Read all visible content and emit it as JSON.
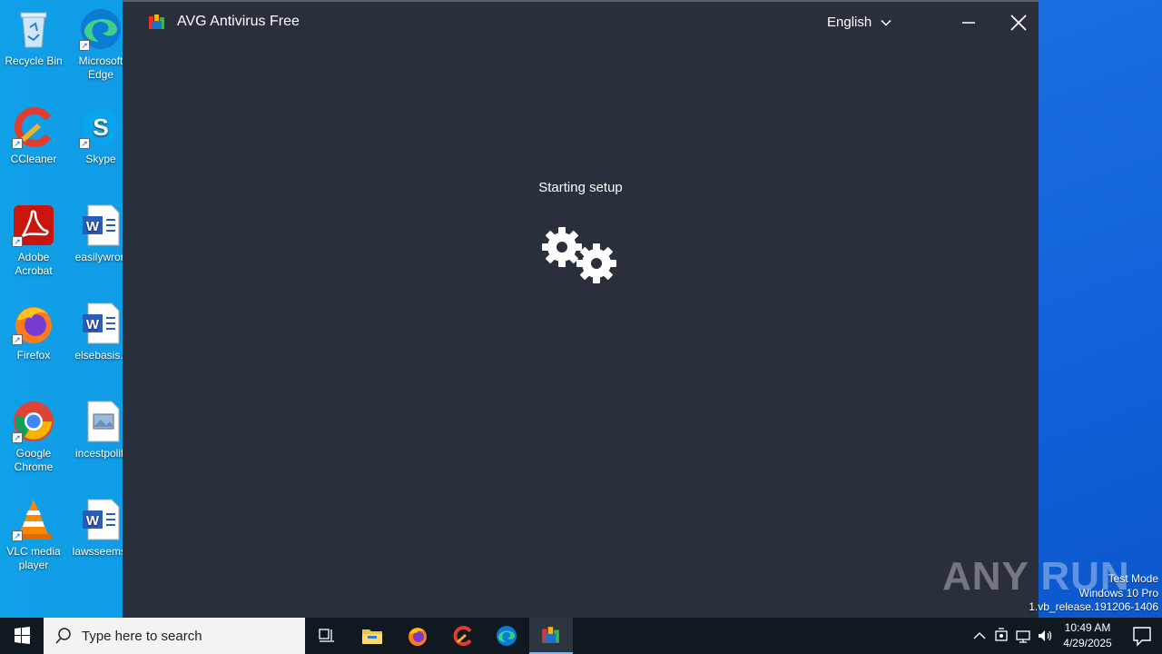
{
  "desktop": {
    "icons": [
      {
        "name": "recycle-bin",
        "label": "Recycle Bin"
      },
      {
        "name": "microsoft-edge",
        "label": "Microsoft Edge"
      },
      {
        "name": "ccleaner",
        "label": "CCleaner"
      },
      {
        "name": "skype",
        "label": "Skype"
      },
      {
        "name": "adobe-acrobat",
        "label": "Adobe Acrobat"
      },
      {
        "name": "easilywron",
        "label": "easilywron"
      },
      {
        "name": "firefox",
        "label": "Firefox"
      },
      {
        "name": "elsebasis",
        "label": "elsebasis.r"
      },
      {
        "name": "google-chrome",
        "label": "Google Chrome"
      },
      {
        "name": "incestpoliti",
        "label": "incestpoliti"
      },
      {
        "name": "vlc",
        "label": "VLC media player"
      },
      {
        "name": "lawsseems",
        "label": "lawsseems."
      }
    ]
  },
  "window": {
    "title": "AVG Antivirus Free",
    "language": "English",
    "status": "Starting setup"
  },
  "watermark": {
    "text": "ANY RUN"
  },
  "system_info": {
    "line1": "Test Mode",
    "line2": "Windows 10 Pro",
    "line3": "1.vb_release.191206-1406"
  },
  "taskbar": {
    "search_placeholder": "Type here to search",
    "time": "10:49 AM",
    "date": "4/29/2025"
  },
  "colors": {
    "window_bg": "#2a2f3c",
    "taskbar_bg": "#101820",
    "desktop_bg": "#0f8fe0"
  }
}
